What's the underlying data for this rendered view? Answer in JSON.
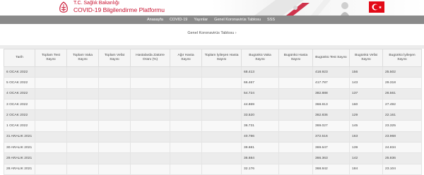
{
  "header": {
    "ministry": "T.C. Sağlık Bakanlığı",
    "platform": "COVID-19 Bilgilendirme Platformu"
  },
  "nav": [
    {
      "label": "Anasayfa"
    },
    {
      "label": "COVID-19"
    },
    {
      "label": "Yayınlar"
    },
    {
      "label": "Genel Koronavirüs Tablosu"
    },
    {
      "label": "SSS"
    }
  ],
  "breadcrumb": "Genel Koronavirüs Tablosu ›",
  "table": {
    "headers": [
      "Tarih",
      "Toplam Test Sayısı",
      "Toplam Vaka Sayısı",
      "Toplam Vefat Sayısı",
      "Hastalarda Zatürre Oranı (%)",
      "Ağır Hasta Sayısı",
      "Toplam İyileşen Hasta Sayısı",
      "Bugünkü Vaka Sayısı",
      "Bugünkü Hasta Sayısı",
      "Bugünkü Test Sayısı",
      "Bugünkü Vefat Sayısı",
      "Bugünkü İyileşen Sayısı"
    ],
    "rows": [
      {
        "date": "6 OCAK 2022",
        "cases": "68.413",
        "tests": "418.923",
        "deaths": "156",
        "recovered": "25.502"
      },
      {
        "date": "5 OCAK 2022",
        "cases": "66.467",
        "tests": "417.787",
        "deaths": "143",
        "recovered": "29.318"
      },
      {
        "date": "4 OCAK 2022",
        "cases": "54.724",
        "tests": "382.888",
        "deaths": "137",
        "recovered": "26.561"
      },
      {
        "date": "3 OCAK 2022",
        "cases": "44.869",
        "tests": "368.813",
        "deaths": "160",
        "recovered": "27.492"
      },
      {
        "date": "2 OCAK 2022",
        "cases": "33.520",
        "tests": "362.836",
        "deaths": "129",
        "recovered": "22.161"
      },
      {
        "date": "1 OCAK 2022",
        "cases": "36.731",
        "tests": "369.027",
        "deaths": "145",
        "recovered": "23.325"
      },
      {
        "date": "31 ARALIK 2021",
        "cases": "40.786",
        "tests": "372.516",
        "deaths": "163",
        "recovered": "23.968"
      },
      {
        "date": "30 ARALIK 2021",
        "cases": "39.681",
        "tests": "369.647",
        "deaths": "139",
        "recovered": "24.834"
      },
      {
        "date": "29 ARALIK 2021",
        "cases": "36.684",
        "tests": "366.363",
        "deaths": "142",
        "recovered": "25.836"
      },
      {
        "date": "28 ARALIK 2021",
        "cases": "32.176",
        "tests": "368.842",
        "deaths": "184",
        "recovered": "23.104"
      }
    ]
  },
  "colors": {
    "brand_red": "#c8102e",
    "nav_bg": "#8a8a8a",
    "row_alt": "#ececec"
  }
}
